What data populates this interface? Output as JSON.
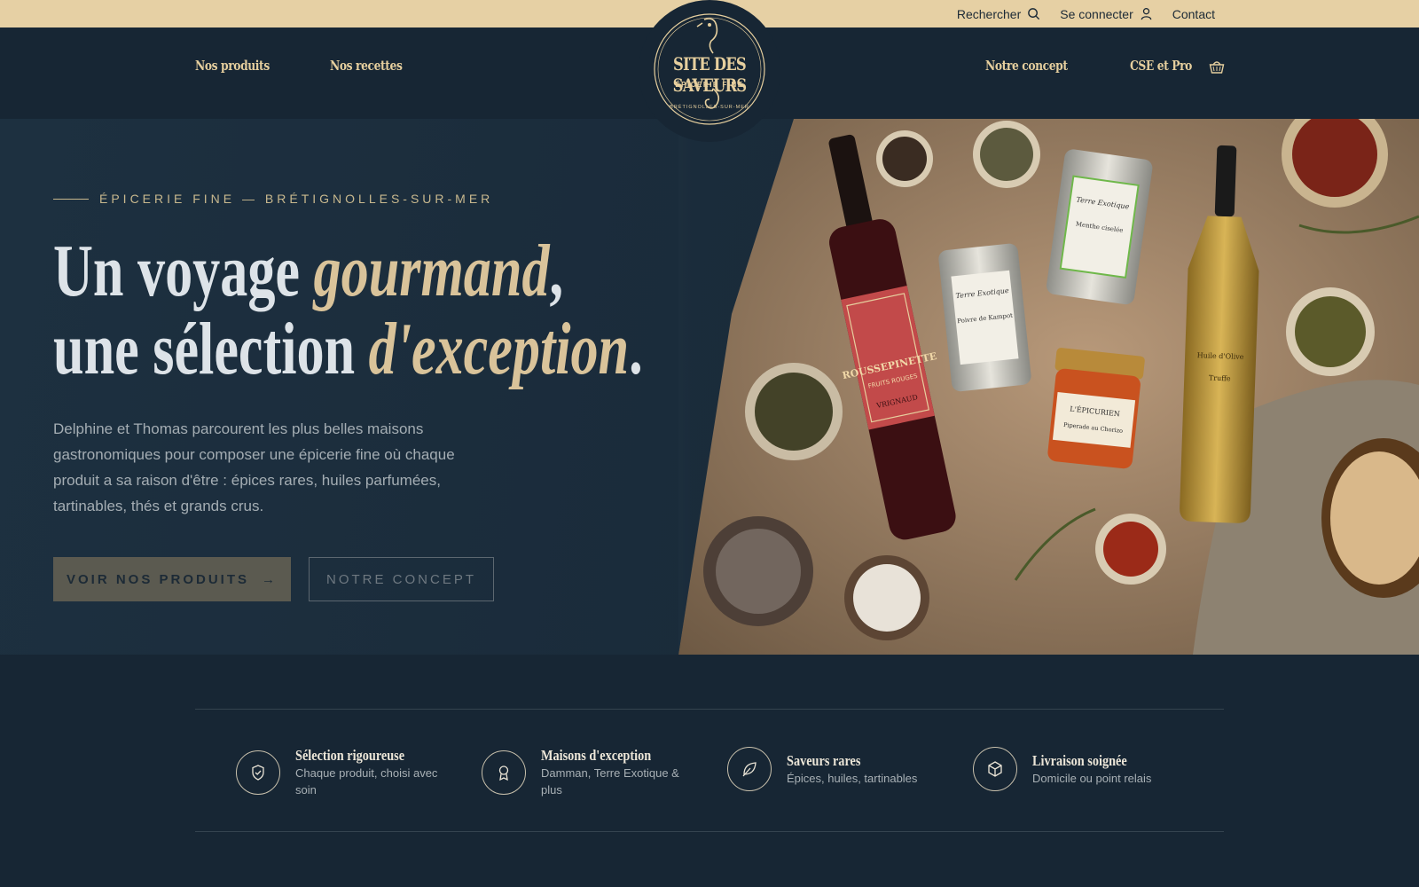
{
  "topbar": {
    "search_label": "Rechercher",
    "search_icon": "search-icon",
    "login_label": "Se connecter",
    "login_icon": "user-icon",
    "contact_label": "Contact",
    "background": "#e6d0a4"
  },
  "nav": {
    "left": [
      "Nos produits",
      "Nos recettes"
    ],
    "right": [
      "Notre concept",
      "CSE et Pro"
    ],
    "basket_icon": "basket-icon"
  },
  "logo": {
    "name": "SITE DES SAVEURS",
    "subtitle": "ÉPICERIE FINE",
    "place": "BRÉTIGNOLLES-SUR-MER",
    "emblem_icon": "seahorse-icon"
  },
  "hero": {
    "eyebrow": "ÉPICERIE FINE — BRÉTIGNOLLES-SUR-MER",
    "headline_line1_plain": "Un voyage ",
    "headline_line1_italic": "gourmand",
    "headline_line1_end": ",",
    "headline_line2_plain": "une sélection ",
    "headline_line2_italic": "d'exception",
    "headline_line2_end": ".",
    "lede": "Delphine et Thomas parcourent les plus belles maisons gastronomiques pour composer une épicerie fine où chaque produit a sa raison d'être : épices rares, huiles parfumées, tartinables, thés et grands crus.",
    "primary_button": "VOIR NOS PRODUITS",
    "primary_arrow": "→",
    "secondary_button": "NOTRE CONCEPT",
    "photo_labels": {
      "wine": "ROUSSEPINETTE",
      "wine_sub": "FRUITS ROUGES",
      "wine_brand": "VRIGNAUD",
      "tin1_brand": "Terre Exotique",
      "tin1_text": "Poivre de Kampot",
      "tin2_brand": "Terre Exotique",
      "tin2_text": "Menthe ciselée",
      "jar_brand": "L'ÉPICURIEN",
      "jar_text": "Piperade au Chorizo",
      "oil_text": "Huile d'Olive",
      "oil_sub": "Truffe"
    }
  },
  "features": [
    {
      "icon": "shield-check-icon",
      "title": "Sélection rigoureuse",
      "desc": "Chaque produit, choisi avec soin"
    },
    {
      "icon": "award-icon",
      "title": "Maisons d'exception",
      "desc": "Damman, Terre Exotique & plus"
    },
    {
      "icon": "leaf-icon",
      "title": "Saveurs rares",
      "desc": "Épices, huiles, tartinables"
    },
    {
      "icon": "box-icon",
      "title": "Livraison soignée",
      "desc": "Domicile ou point relais"
    }
  ],
  "colors": {
    "navy": "#172634",
    "gold": "#e6cf9e",
    "sand": "#e6d0a4"
  }
}
